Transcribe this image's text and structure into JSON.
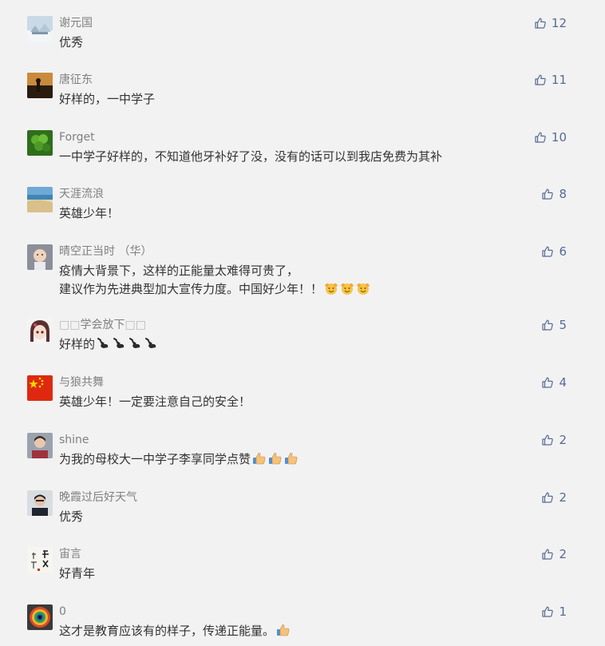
{
  "comments": [
    {
      "nickname": "谢元国",
      "lines": [
        "优秀"
      ],
      "likes": "12",
      "avatar": "snow-landscape-avatar"
    },
    {
      "nickname": "唐征东",
      "lines": [
        "好样的，一中学子"
      ],
      "likes": "11",
      "avatar": "sunset-silhouette-avatar"
    },
    {
      "nickname": "Forget",
      "lines": [
        "一中学子好样的，不知道他牙补好了没，没有的话可以到我店免费为其补"
      ],
      "likes": "10",
      "avatar": "green-clover-avatar"
    },
    {
      "nickname": "天涯流浪",
      "lines": [
        "英雄少年！"
      ],
      "likes": "8",
      "avatar": "beach-avatar"
    },
    {
      "nickname": "晴空正当时 （华）",
      "lines": [
        "疫情大背景下，这样的正能量太难得可贵了，",
        "建议作为先进典型加大宣传力度。中国好少年！！"
      ],
      "likes": "6",
      "avatar": "child-portrait-avatar",
      "emoji": [
        "applause-emoji",
        "applause-emoji",
        "applause-emoji"
      ]
    },
    {
      "nickname_prefix": "□□",
      "nickname": "学会放下",
      "nickname_suffix": "□□",
      "lines": [
        "好样的"
      ],
      "likes": "5",
      "avatar": "anime-girl-avatar",
      "emoji": [
        "pointing-hand-emoji",
        "pointing-hand-emoji",
        "pointing-hand-emoji",
        "pointing-hand-emoji"
      ]
    },
    {
      "nickname": "与狼共舞",
      "lines": [
        "英雄少年！一定要注意自己的安全！"
      ],
      "likes": "4",
      "avatar": "china-flag-avatar"
    },
    {
      "nickname": "shine",
      "lines": [
        "为我的母校大一中学子李享同学点赞"
      ],
      "likes": "2",
      "avatar": "portrait-avatar",
      "emoji": [
        "thumbs-up-emoji",
        "thumbs-up-emoji",
        "thumbs-up-emoji"
      ]
    },
    {
      "nickname": "晚霞过后好天气",
      "lines": [
        "优秀"
      ],
      "likes": "2",
      "avatar": "man-portrait-avatar"
    },
    {
      "nickname": "宙言",
      "lines": [
        "好青年"
      ],
      "likes": "2",
      "avatar": "calligraphy-avatar"
    },
    {
      "nickname": "0",
      "lines": [
        "这才是教育应该有的样子，传递正能量。"
      ],
      "likes": "1",
      "avatar": "colorful-eye-avatar",
      "emoji": [
        "thumbs-up-emoji"
      ]
    }
  ],
  "colors": {
    "background": "#f2f2f2",
    "nickname": "#808080",
    "content": "#333333",
    "like": "#576b95"
  },
  "like_icon": "thumbs-up-outline-icon"
}
